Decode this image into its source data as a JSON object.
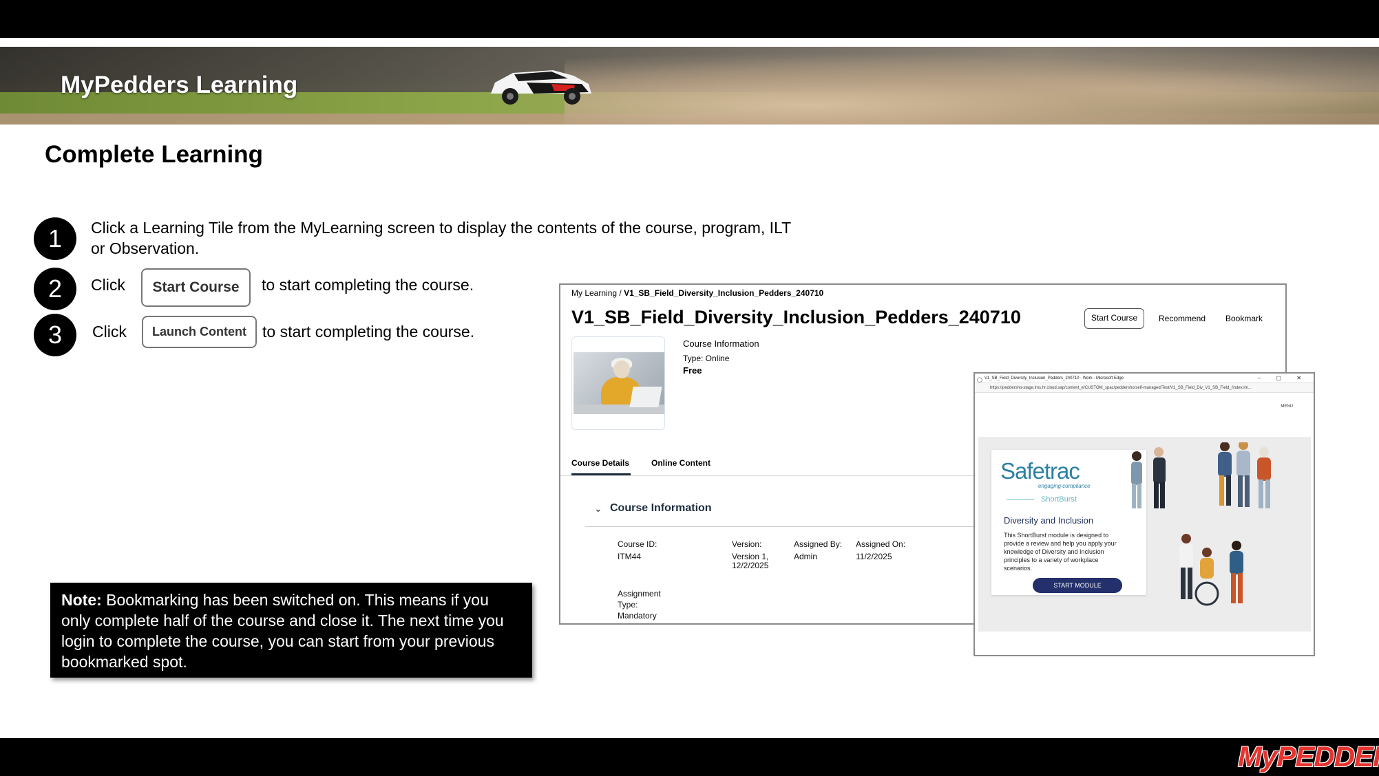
{
  "banner": {
    "title": "MyPedders Learning"
  },
  "page": {
    "title": "Complete Learning"
  },
  "steps": [
    {
      "number": "1",
      "text": "Click a Learning Tile from the MyLearning screen to display the contents of the course, program, ILT",
      "text_line2": "or Observation."
    },
    {
      "number": "2",
      "prefix": "Click",
      "button": "Start Course",
      "suffix": "to start completing the course."
    },
    {
      "number": "3",
      "prefix": "Click",
      "button": "Launch Content",
      "suffix": "to start completing the course."
    }
  ],
  "note": {
    "label": "Note:",
    "text": " Bookmarking has been switched on. This means if you only complete half of the course and close it. The next time you login to complete the course, you can start from your previous bookmarked spot."
  },
  "course_page": {
    "breadcrumb_root": "My Learning",
    "breadcrumb_sep": " / ",
    "breadcrumb_current": "V1_SB_Field_Diversity_Inclusion_Pedders_240710",
    "title": "V1_SB_Field_Diversity_Inclusion_Pedders_240710",
    "actions": {
      "start": "Start Course",
      "recommend": "Recommend",
      "bookmark": "Bookmark"
    },
    "info_label": "Course Information",
    "type": "Type: Online",
    "price": "Free",
    "tabs": [
      "Course Details",
      "Online Content"
    ],
    "section_title": "Course Information",
    "fields": {
      "course_id_label": "Course ID:",
      "course_id": "ITM44",
      "version_label": "Version:",
      "version": "Version 1,",
      "version_date": "12/2/2025",
      "assigned_by_label": "Assigned By:",
      "assigned_by": "Admin",
      "assigned_on_label": "Assigned On:",
      "assigned_on": "11/2/2025",
      "assignment_type_label": "Assignment",
      "assignment_type_label2": "Type:",
      "assignment_type": "Mandatory"
    }
  },
  "browser": {
    "window_title": "V1_SB_Field_Diversity_Inclusion_Pedders_240710 - Work - Microsoft Edge",
    "controls": "– ▢ ✕",
    "url": "https://peddersho-stage.lms.hr.cloud.sap/content_e/CUSTOM_spac/peddersho/self-managed/Test/V1_SB_Field_Div_V1_SB_Field_/index.lm...",
    "menu": "MENU",
    "module": {
      "brand": "Safetrac",
      "tagline": "engaging compliance",
      "product": "ShortBurst",
      "title": "Diversity and Inclusion",
      "description": "This ShortBurst module is designed to provide a review and help you apply your knowledge of Diversity and Inclusion principles to a variety of workplace scenarios.",
      "button": "START MODULE"
    }
  },
  "logo": {
    "text": "MyPEDDERS",
    "color": "#e8322d"
  },
  "colors": {
    "bar": "#000000",
    "accent_navy": "#24306b",
    "safetrac_teal": "#2b7fa3"
  }
}
